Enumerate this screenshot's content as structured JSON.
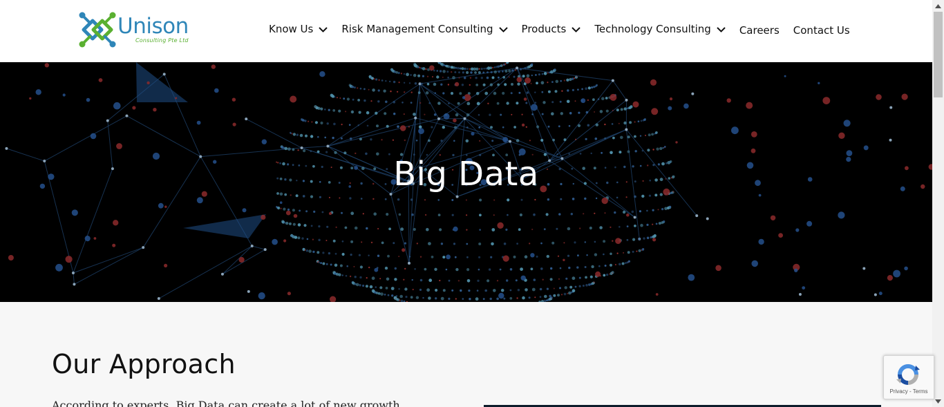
{
  "brand": {
    "name": "Unison",
    "tagline": "Consulting Pte Ltd",
    "colors": {
      "blue": "#2f86b8",
      "green": "#5ab031"
    }
  },
  "nav": {
    "items": [
      {
        "label": "Know Us",
        "has_dropdown": true
      },
      {
        "label": "Risk Management Consulting",
        "has_dropdown": true
      },
      {
        "label": "Products",
        "has_dropdown": true
      },
      {
        "label": "Technology Consulting",
        "has_dropdown": true
      },
      {
        "label": "Careers",
        "has_dropdown": false
      },
      {
        "label": "Contact Us",
        "has_dropdown": false
      }
    ]
  },
  "hero": {
    "title": "Big Data",
    "background": "#000000"
  },
  "approach": {
    "heading": "Our Approach",
    "body_partial": "According to experts, Big Data can create a lot of new growth"
  },
  "recaptcha": {
    "privacy": "Privacy",
    "separator": " - ",
    "terms": "Terms"
  }
}
